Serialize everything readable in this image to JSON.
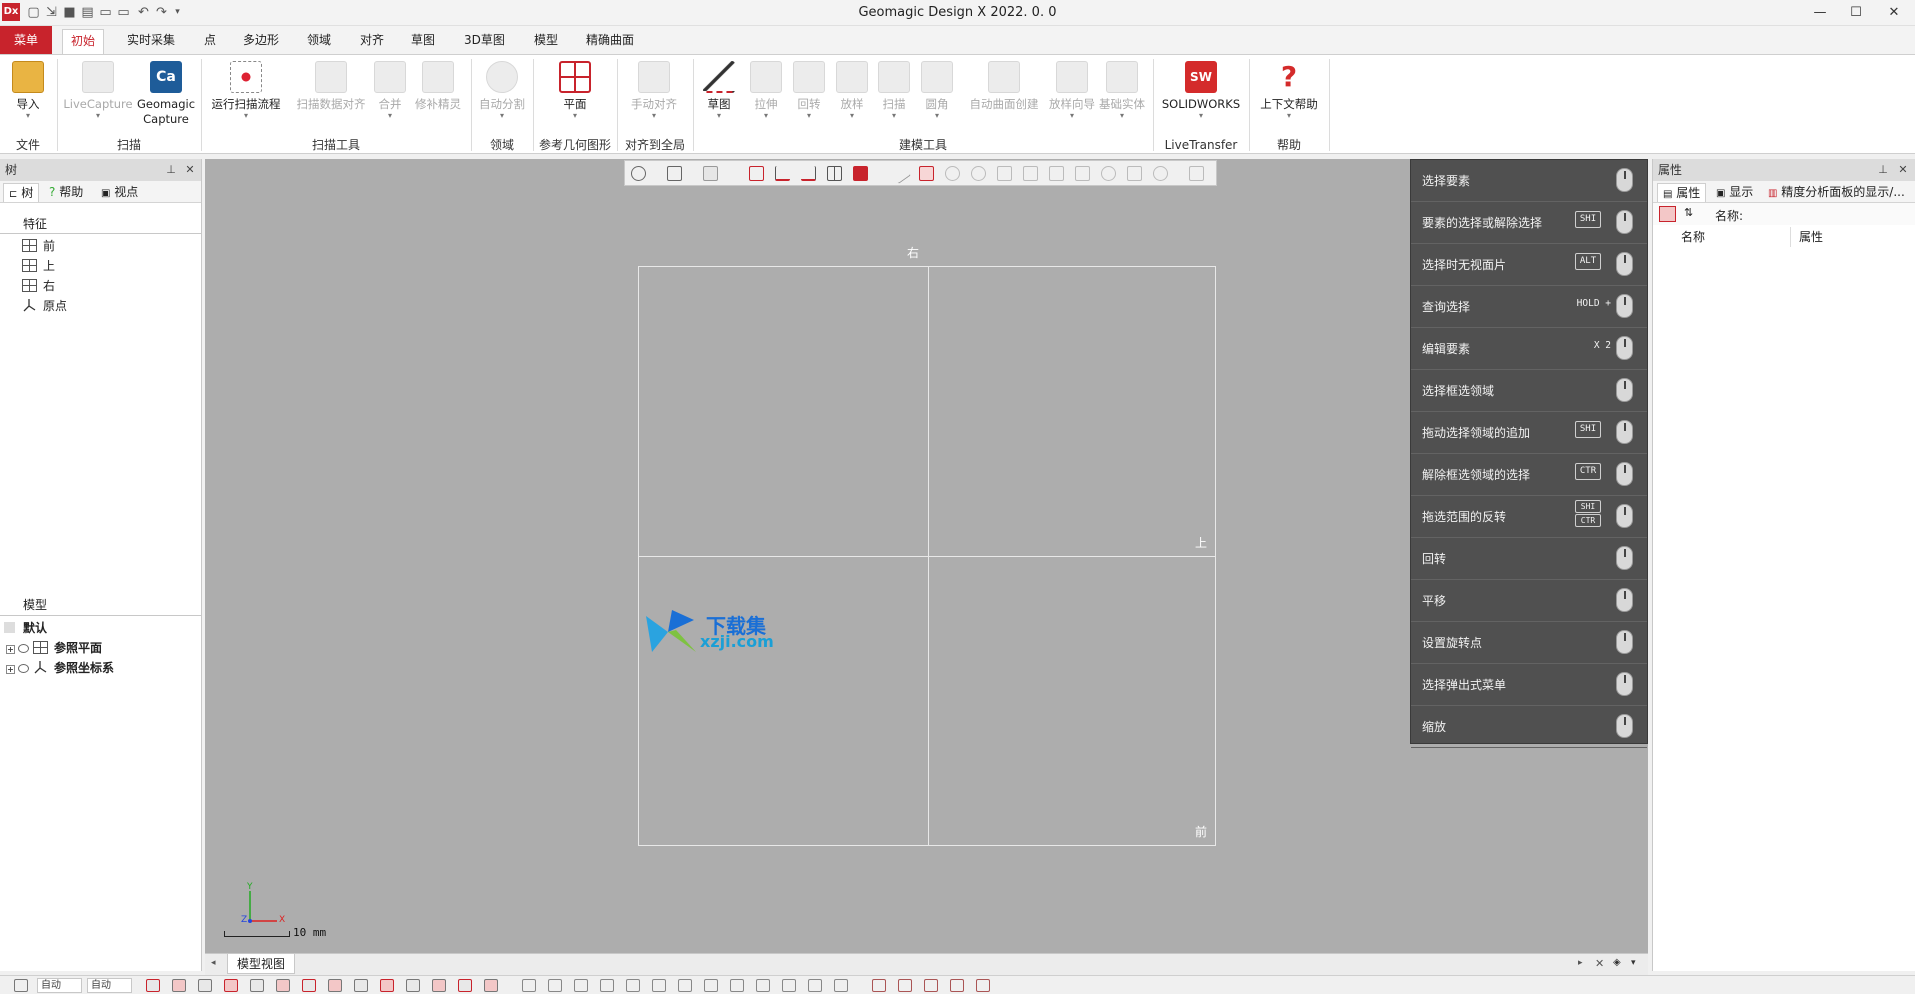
{
  "app": {
    "logo": "Dx",
    "title": "Geomagic Design X 2022. 0. 0",
    "window_controls": [
      "minimize-icon",
      "maximize-icon",
      "close-icon"
    ]
  },
  "menu_tabs": [
    {
      "id": "tab-menu",
      "label": "菜单"
    },
    {
      "id": "tab-home",
      "label": "初始"
    },
    {
      "id": "tab-realtime",
      "label": "实时采集"
    },
    {
      "id": "tab-point",
      "label": "点"
    },
    {
      "id": "tab-polygon",
      "label": "多边形"
    },
    {
      "id": "tab-region",
      "label": "领域"
    },
    {
      "id": "tab-align",
      "label": "对齐"
    },
    {
      "id": "tab-sketch",
      "label": "草图"
    },
    {
      "id": "tab-3dsketch",
      "label": "3D草图"
    },
    {
      "id": "tab-model",
      "label": "模型"
    },
    {
      "id": "tab-surface",
      "label": "精确曲面"
    }
  ],
  "ribbon": {
    "buttons": {
      "import": "导入",
      "livecapture": "LiveCapture",
      "geomagic1": "Geomagic",
      "geomagic2": "Capture",
      "run_scan": "运行扫描流程",
      "scan_align": "扫描数据对齐",
      "merge": "合并",
      "repair": "修补精灵",
      "auto_split": "自动分割",
      "plane": "平面",
      "manual_align": "手动对齐",
      "sketch": "草图",
      "extrude": "拉伸",
      "revolve": "回转",
      "loft": "放样",
      "sweep": "扫描",
      "fillet": "圆角",
      "auto_surface": "自动曲面创建",
      "loft_wizard": "放样向导",
      "base_solid": "基础实体",
      "solidworks": "SOLIDWORKS",
      "context_help": "上下文帮助"
    },
    "groups": {
      "file": "文件",
      "scan": "扫描",
      "scan_tools": "扫描工具",
      "region": "领域",
      "ref_geometry": "参考几何图形",
      "align_global": "对齐到全局",
      "modeling_tools": "建模工具",
      "livetransfer": "LiveTransfer",
      "help": "帮助"
    }
  },
  "left_panel": {
    "title": "树",
    "tabs": [
      "树",
      "帮助",
      "视点"
    ],
    "features_title": "特征",
    "features": [
      "前",
      "上",
      "右",
      "原点"
    ],
    "model_title": "模型",
    "model_items": [
      "默认",
      "参照平面",
      "参照坐标系"
    ]
  },
  "viewport": {
    "labels": {
      "top": "右",
      "mid_right": "上",
      "bottom_right": "前"
    },
    "watermark": {
      "line1": "下载集",
      "line2": "xzji.com"
    },
    "axis": {
      "y": "Y",
      "z": "Z",
      "x": "X"
    },
    "scale": "10 mm",
    "tab": "模型视图"
  },
  "mouse_help": [
    {
      "label": "选择要素",
      "key": ""
    },
    {
      "label": "要素的选择或解除选择",
      "key": "SHI"
    },
    {
      "label": "选择时无视面片",
      "key": "ALT"
    },
    {
      "label": "查询选择",
      "text": "HOLD +"
    },
    {
      "label": "编辑要素",
      "text": "X 2"
    },
    {
      "label": "选择框选领域",
      "key": ""
    },
    {
      "label": "拖动选择领域的追加",
      "key": "SHI"
    },
    {
      "label": "解除框选领域的选择",
      "key": "CTR"
    },
    {
      "label": "拖选范围的反转",
      "key": "SHI",
      "key2": "CTR"
    },
    {
      "label": "回转",
      "key": ""
    },
    {
      "label": "平移",
      "key": ""
    },
    {
      "label": "设置旋转点",
      "key": ""
    },
    {
      "label": "选择弹出式菜单",
      "key": ""
    },
    {
      "label": "缩放",
      "key": ""
    }
  ],
  "right_panel": {
    "title": "属性",
    "tabs": [
      "属性",
      "显示",
      "精度分析面板的显示/..."
    ],
    "name_label": "名称:",
    "columns": [
      "名称",
      "属性"
    ]
  },
  "status": {
    "combo1": "自动",
    "combo2": "自动"
  },
  "colors": {
    "accent": "#c8232c",
    "viewport_bg": "#adadad",
    "mouse_panel_bg": "#505050"
  }
}
